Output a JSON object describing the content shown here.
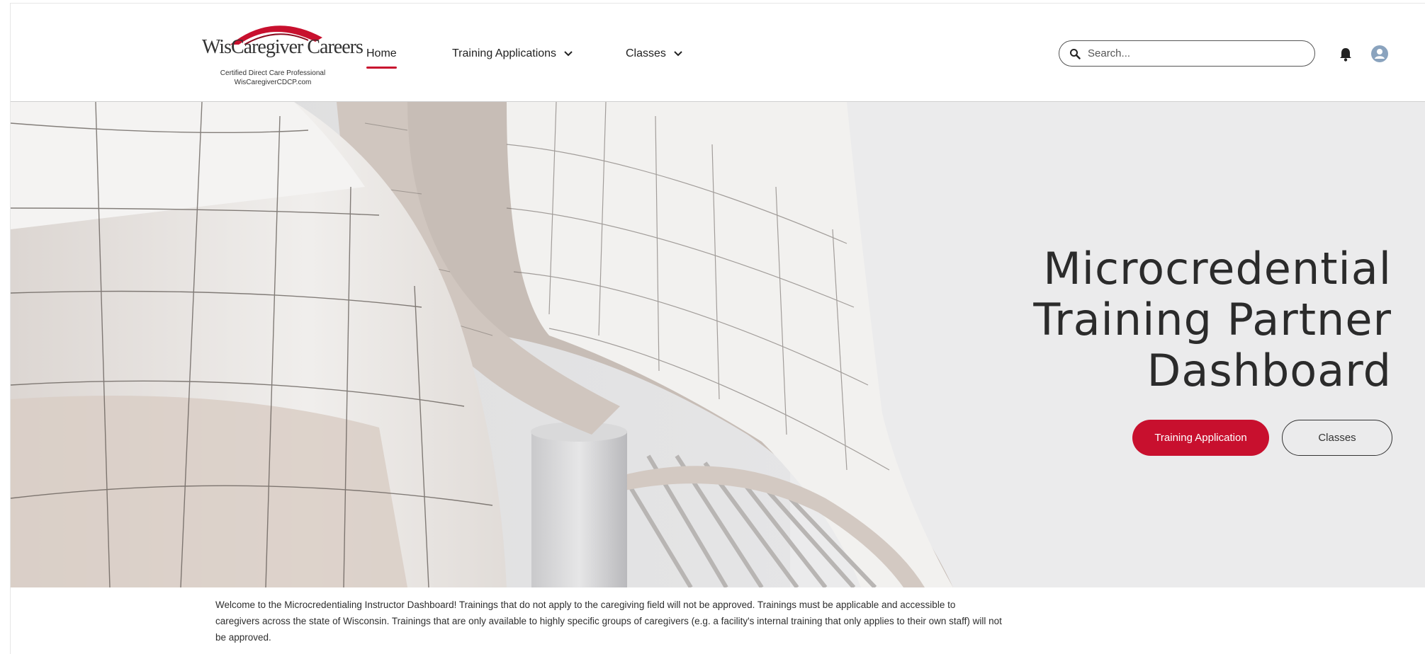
{
  "logo": {
    "title": "WisCaregiver Careers",
    "subtitle_line1": "Certified Direct Care Professional",
    "subtitle_line2": "WisCaregiverCDCP.com"
  },
  "nav": {
    "home": "Home",
    "training_applications": "Training Applications",
    "classes": "Classes"
  },
  "search": {
    "placeholder": "Search..."
  },
  "icons": {
    "search": "search-icon",
    "bell": "bell-icon",
    "user": "user-icon",
    "chevron": "chevron-down-icon"
  },
  "colors": {
    "accent": "#c8102e",
    "text": "#2b2b2b"
  },
  "hero": {
    "title_line1": "Microcredential",
    "title_line2": "Training Partner",
    "title_line3": "Dashboard",
    "primary_button": "Training Application",
    "secondary_button": "Classes"
  },
  "welcome_text": "Welcome to the Microcredentialing Instructor Dashboard! Trainings that do not apply to the caregiving field will not be approved. Trainings must be applicable and accessible to caregivers across the state of Wisconsin. Trainings that are only available to highly specific groups of caregivers (e.g. a facility's internal training that only applies to their own staff) will not be approved."
}
